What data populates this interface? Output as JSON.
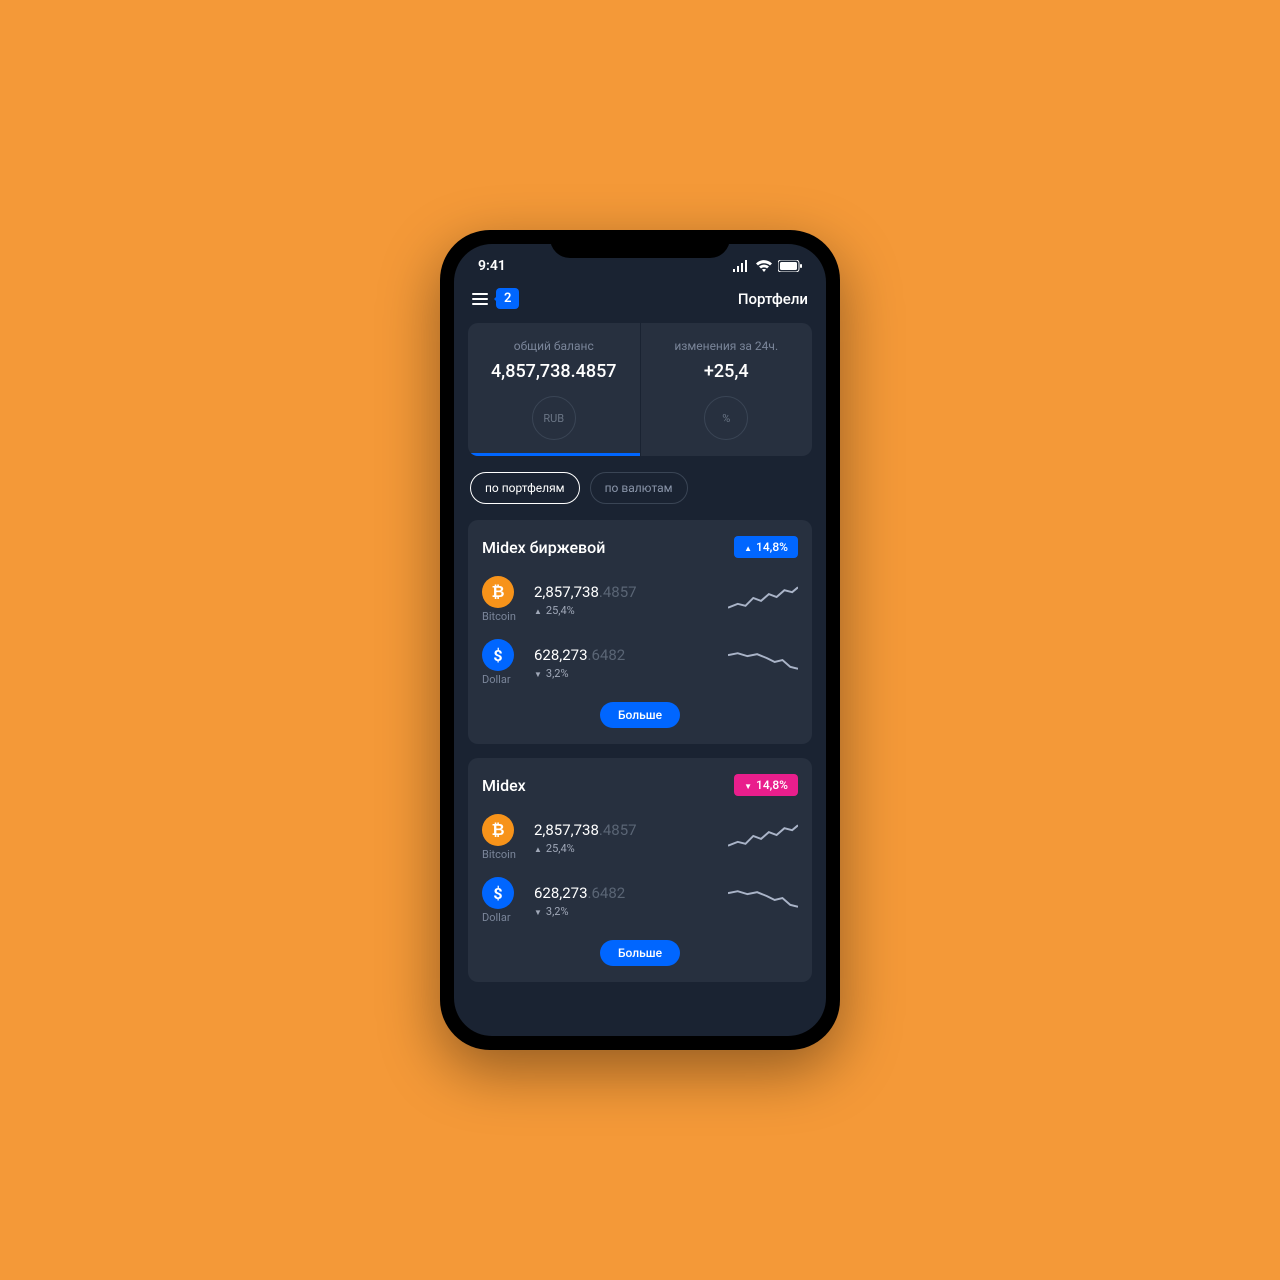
{
  "statusBar": {
    "time": "9:41"
  },
  "header": {
    "badgeCount": "2",
    "title": "Портфели"
  },
  "balance": {
    "left": {
      "label": "общий баланс",
      "value": "4,857,738.4857",
      "unit": "RUB"
    },
    "right": {
      "label": "изменения за 24ч.",
      "value": "+25,4",
      "unit": "%"
    }
  },
  "filters": {
    "byPortfolios": "по портфелям",
    "byCurrencies": "по валютам"
  },
  "portfolios": [
    {
      "name": "Midex биржевой",
      "changeDir": "up",
      "changeValue": "14,8%",
      "assets": [
        {
          "icon": "btc",
          "iconLabel": "₿",
          "name": "Bitcoin",
          "valueMain": "2,857,738",
          "valueDec": ".4857",
          "changeDir": "up",
          "change": "25,4%",
          "trend": "up"
        },
        {
          "icon": "usd",
          "iconLabel": "$",
          "name": "Dollar",
          "valueMain": "628,273",
          "valueDec": ".6482",
          "changeDir": "down",
          "change": "3,2%",
          "trend": "down"
        }
      ],
      "more": "Больше"
    },
    {
      "name": "Midex",
      "changeDir": "down",
      "changeValue": "14,8%",
      "assets": [
        {
          "icon": "btc",
          "iconLabel": "₿",
          "name": "Bitcoin",
          "valueMain": "2,857,738",
          "valueDec": ".4857",
          "changeDir": "up",
          "change": "25,4%",
          "trend": "up"
        },
        {
          "icon": "usd",
          "iconLabel": "$",
          "name": "Dollar",
          "valueMain": "628,273",
          "valueDec": ".6482",
          "changeDir": "down",
          "change": "3,2%",
          "trend": "down"
        }
      ],
      "more": "Больше"
    }
  ]
}
